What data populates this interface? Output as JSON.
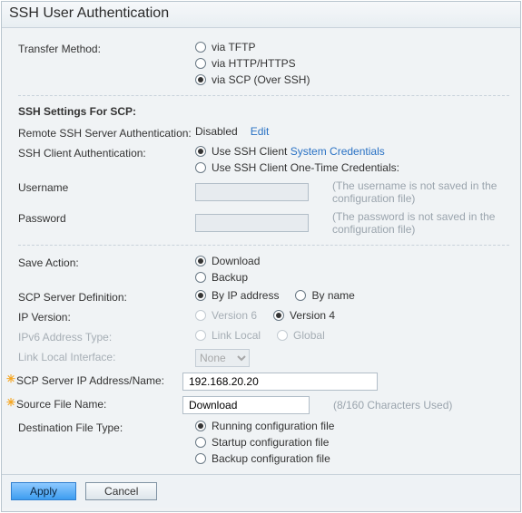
{
  "title": "SSH User Authentication",
  "transfer": {
    "label": "Transfer Method:",
    "options": [
      "via TFTP",
      "via HTTP/HTTPS",
      "via SCP (Over SSH)"
    ],
    "selected": 2
  },
  "scp_section_title": "SSH Settings For SCP:",
  "remote_auth": {
    "label": "Remote SSH Server Authentication:",
    "value": "Disabled",
    "edit": "Edit"
  },
  "client_auth": {
    "label": "SSH Client Authentication:",
    "options": {
      "sys_prefix": "Use SSH Client ",
      "sys_link": "System Credentials",
      "onetime": "Use SSH Client One-Time Credentials:"
    },
    "selected": 0
  },
  "username": {
    "label": "Username",
    "value": "",
    "hint": "(The username is not saved in the configuration file)"
  },
  "password": {
    "label": "Password",
    "value": "",
    "hint": "(The password is not saved in the configuration file)"
  },
  "save_action": {
    "label": "Save Action:",
    "options": [
      "Download",
      "Backup"
    ],
    "selected": 0
  },
  "server_def": {
    "label": "SCP Server Definition:",
    "options": [
      "By IP address",
      "By name"
    ],
    "selected": 0
  },
  "ip_version": {
    "label": "IP Version:",
    "options": [
      "Version 6",
      "Version 4"
    ],
    "selected": 1
  },
  "ipv6_type": {
    "label": "IPv6 Address Type:",
    "options": [
      "Link Local",
      "Global"
    ]
  },
  "link_local_if": {
    "label": "Link Local Interface:",
    "value": "None"
  },
  "server_addr": {
    "label": "SCP Server IP Address/Name:",
    "value": "192.168.20.20"
  },
  "source_file": {
    "label": "Source File Name:",
    "value": "Download",
    "hint": "(8/160 Characters Used)"
  },
  "dest_file": {
    "label": "Destination File Type:",
    "options": [
      "Running configuration file",
      "Startup configuration file",
      "Backup configuration file"
    ],
    "selected": 0
  },
  "buttons": {
    "apply": "Apply",
    "cancel": "Cancel"
  }
}
